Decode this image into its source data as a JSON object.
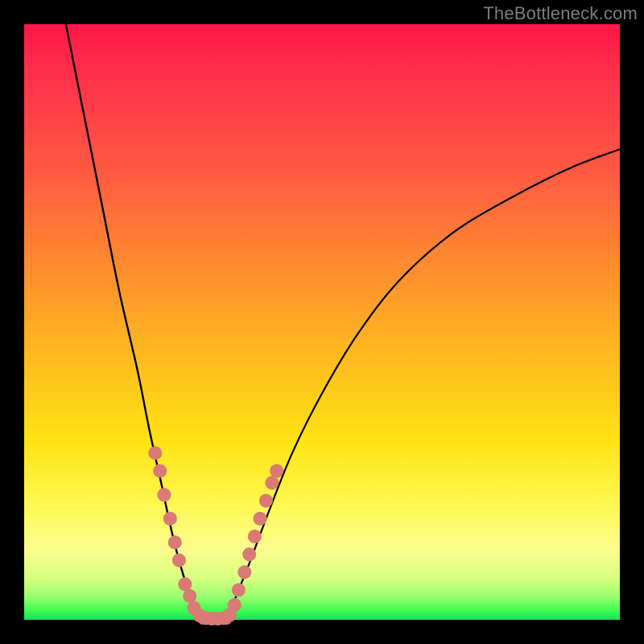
{
  "watermark": {
    "text": "TheBottleneck.com"
  },
  "chart_data": {
    "type": "line",
    "title": "",
    "xlabel": "",
    "ylabel": "",
    "xlim": [
      0,
      100
    ],
    "ylim": [
      0,
      100
    ],
    "left_curve": {
      "name": "left-branch",
      "x": [
        7,
        10,
        13,
        16,
        19,
        21,
        23,
        24.5,
        26,
        27.5,
        28.5,
        30
      ],
      "y": [
        100,
        85,
        70,
        55,
        42,
        32,
        23,
        16,
        10,
        5,
        2,
        0
      ]
    },
    "right_curve": {
      "name": "right-branch",
      "x": [
        34,
        36,
        38,
        41,
        45,
        50,
        56,
        63,
        72,
        82,
        92,
        100
      ],
      "y": [
        0,
        5,
        10,
        18,
        28,
        38,
        48,
        57,
        65,
        71,
        76,
        79
      ]
    },
    "bottom_flat": {
      "name": "valley-floor",
      "x": [
        30,
        34
      ],
      "y": [
        0,
        0
      ]
    },
    "markers_pink": {
      "name": "pink-dots",
      "color": "#d97b74",
      "points": [
        {
          "x": 22.0,
          "y": 28
        },
        {
          "x": 22.8,
          "y": 25
        },
        {
          "x": 23.5,
          "y": 21
        },
        {
          "x": 24.5,
          "y": 17
        },
        {
          "x": 25.3,
          "y": 13
        },
        {
          "x": 26.0,
          "y": 10
        },
        {
          "x": 27.0,
          "y": 6
        },
        {
          "x": 27.8,
          "y": 4
        },
        {
          "x": 28.5,
          "y": 2
        },
        {
          "x": 29.5,
          "y": 0.7
        },
        {
          "x": 30.5,
          "y": 0.3
        },
        {
          "x": 31.5,
          "y": 0.2
        },
        {
          "x": 32.5,
          "y": 0.2
        },
        {
          "x": 33.5,
          "y": 0.3
        },
        {
          "x": 34.5,
          "y": 0.8
        },
        {
          "x": 35.3,
          "y": 2.5
        },
        {
          "x": 36.0,
          "y": 5
        },
        {
          "x": 37.0,
          "y": 8
        },
        {
          "x": 37.8,
          "y": 11
        },
        {
          "x": 38.7,
          "y": 14
        },
        {
          "x": 39.6,
          "y": 17
        },
        {
          "x": 40.6,
          "y": 20
        },
        {
          "x": 41.6,
          "y": 23
        },
        {
          "x": 42.4,
          "y": 25
        }
      ]
    }
  }
}
